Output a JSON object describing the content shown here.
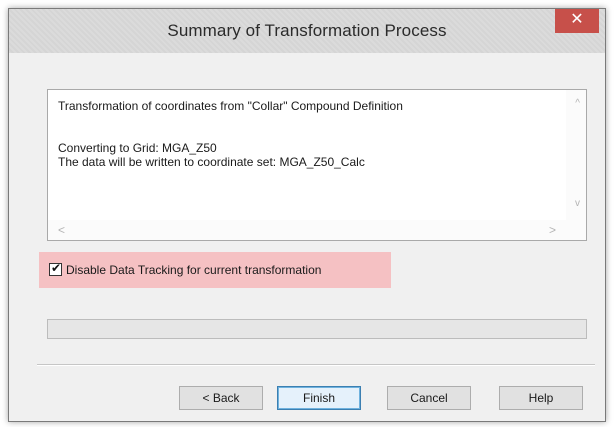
{
  "window": {
    "title": "Summary of Transformation Process",
    "close_label": "✕"
  },
  "summary": {
    "line1": "Transformation of coordinates from \"Collar\" Compound Definition",
    "line2": "Converting to Grid: MGA_Z50",
    "line3": "The data will be written to coordinate set: MGA_Z50_Calc"
  },
  "checkbox": {
    "label": "Disable Data Tracking for current transformation",
    "checked": true,
    "check_glyph": "✔"
  },
  "progress": {
    "value": 0
  },
  "buttons": {
    "back": "< Back",
    "finish": "Finish",
    "cancel": "Cancel",
    "help": "Help"
  },
  "scroll_icons": {
    "up": "^",
    "down": "v",
    "left": "<",
    "right": ">"
  }
}
